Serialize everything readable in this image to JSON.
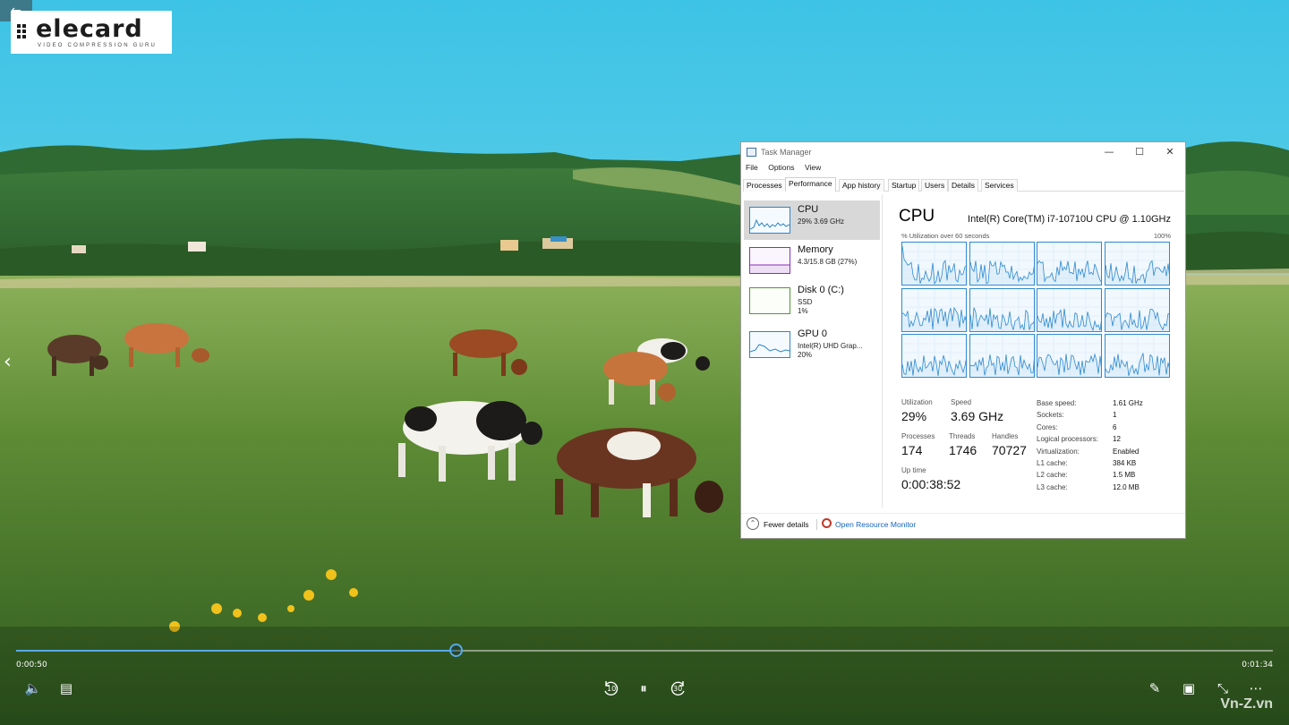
{
  "player": {
    "back_icon": "←",
    "prev_icon": "‹",
    "time_elapsed": "0:00:50",
    "time_total": "0:01:34",
    "progress": 0.35,
    "volume_icon": "🔈",
    "captions_icon": "▤",
    "rewind_label": "10",
    "pause_icon": "⏸",
    "forward_label": "30",
    "edit_icon": "✎",
    "miniview_icon": "▣",
    "fullscreen_icon": "⤡",
    "more_icon": "⋯",
    "accent_color": "#58a9e6"
  },
  "logo": {
    "word": "elecard",
    "tagline": "VIDEO COMPRESSION GURU"
  },
  "watermark": "Vn-Z.vn",
  "task_manager": {
    "title": "Task Manager",
    "window_buttons": {
      "minimize": "—",
      "maximize": "☐",
      "close": "✕"
    },
    "menu": [
      "File",
      "Options",
      "View"
    ],
    "tabs": [
      "Processes",
      "Performance",
      "App history",
      "Startup",
      "Users",
      "Details",
      "Services"
    ],
    "active_tab": "Performance",
    "resources": [
      {
        "name": "CPU",
        "line1": "29% 3.69 GHz",
        "line2": "",
        "graph_color": "#2c84c6"
      },
      {
        "name": "Memory",
        "line1": "4.3/15.8 GB (27%)",
        "line2": "",
        "graph_color": "#8b2fb8"
      },
      {
        "name": "Disk 0 (C:)",
        "line1": "SSD",
        "line2": "1%",
        "graph_color": "#4d9a2f"
      },
      {
        "name": "GPU 0",
        "line1": "Intel(R) UHD Grap...",
        "line2": "20%",
        "graph_color": "#2c84c6"
      }
    ],
    "heading": "CPU",
    "cpu_name": "Intel(R) Core(TM) i7-10710U CPU @ 1.10GHz",
    "util_label": "% Utilization over 60 seconds",
    "util_max": "100%",
    "stats": {
      "utilization_label": "Utilization",
      "utilization": "29%",
      "speed_label": "Speed",
      "speed": "3.69 GHz",
      "processes_label": "Processes",
      "processes": "174",
      "threads_label": "Threads",
      "threads": "1746",
      "handles_label": "Handles",
      "handles": "70727",
      "uptime_label": "Up time",
      "uptime": "0:00:38:52"
    },
    "details": [
      {
        "k": "Base speed:",
        "v": "1.61 GHz"
      },
      {
        "k": "Sockets:",
        "v": "1"
      },
      {
        "k": "Cores:",
        "v": "6"
      },
      {
        "k": "Logical processors:",
        "v": "12"
      },
      {
        "k": "Virtualization:",
        "v": "Enabled"
      },
      {
        "k": "L1 cache:",
        "v": "384 KB"
      },
      {
        "k": "L2 cache:",
        "v": "1.5 MB"
      },
      {
        "k": "L3 cache:",
        "v": "12.0 MB"
      }
    ],
    "fewer_details": "Fewer details",
    "fewer_icon": "⌃",
    "open_resource_monitor": "Open Resource Monitor"
  }
}
